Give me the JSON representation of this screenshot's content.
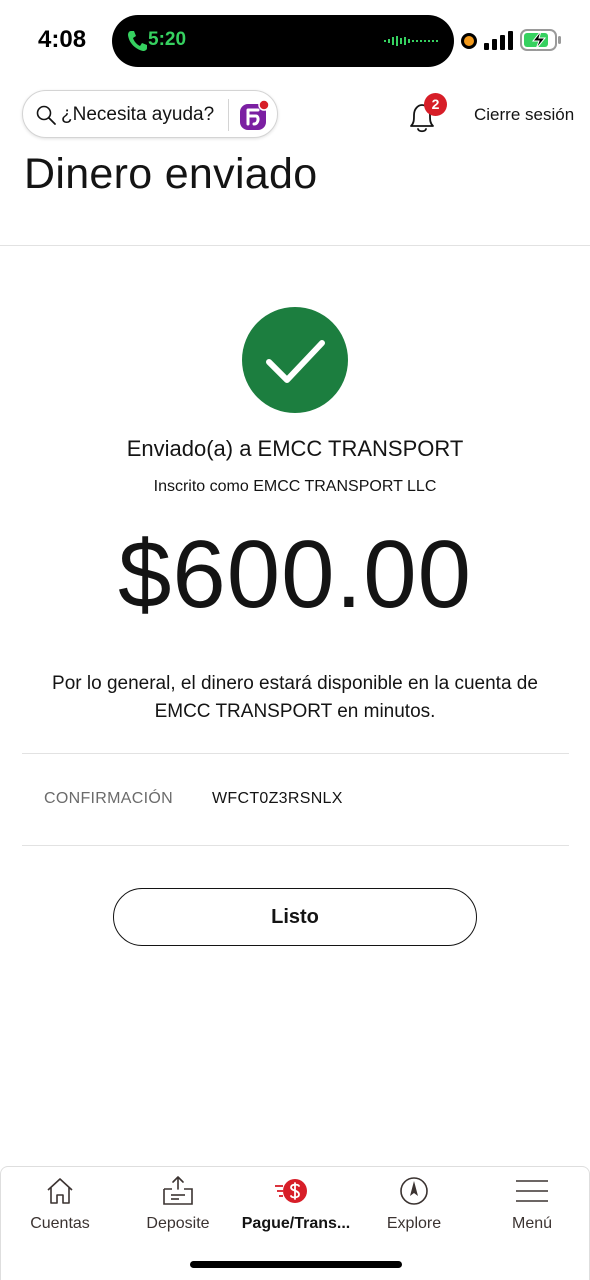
{
  "status_bar": {
    "time": "4:08",
    "call_duration": "5:20",
    "call_color": "#36d160",
    "recording_color": "#f39a1c",
    "battery_color": "#36d160"
  },
  "header": {
    "help_placeholder": "¿Necesita ayuda?",
    "notification_count": "2",
    "logout_label": "Cierre sesión",
    "brand_color": "#d71e28",
    "assistant_icon_color": "#7b1fa2"
  },
  "page_title": "Dinero enviado",
  "confirmation": {
    "status_icon": "check-icon",
    "status_color": "#1c7e3f",
    "sent_to": "Enviado(a) a EMCC TRANSPORT",
    "registered_as": "Inscrito como EMCC TRANSPORT LLC",
    "amount": "$600.00",
    "availability_note": "Por lo general, el dinero estará disponible en la cuenta de EMCC TRANSPORT en minutos.",
    "confirmation_label": "CONFIRMACIÓN",
    "confirmation_number": "WFCT0Z3RSNLX"
  },
  "done_button": "Listo",
  "bottom_nav": {
    "items": [
      {
        "label": "Cuentas",
        "icon": "home-icon",
        "active": false
      },
      {
        "label": "Deposite",
        "icon": "deposit-icon",
        "active": false
      },
      {
        "label": "Pague/Trans...",
        "icon": "pay-transfer-icon",
        "active": true
      },
      {
        "label": "Explore",
        "icon": "compass-icon",
        "active": false
      },
      {
        "label": "Menú",
        "icon": "hamburger-menu-icon",
        "active": false
      }
    ]
  }
}
